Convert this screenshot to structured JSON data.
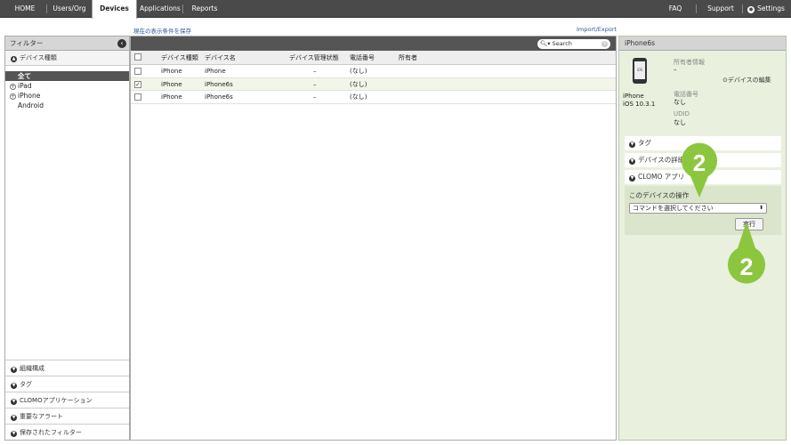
{
  "nav": {
    "items": [
      "HOME",
      "Users/Org",
      "Devices",
      "Applications",
      "Reports"
    ],
    "active": "Devices",
    "right_items": [
      "FAQ",
      "Support",
      "Settings"
    ]
  },
  "links": {
    "save_view": "現在の表示条件を保存",
    "import_export": "Import/Export"
  },
  "filter": {
    "title": "フィルター",
    "device_type_header": "デバイス種類",
    "all_label": "全て",
    "devices": [
      "iPad",
      "iPhone",
      "Android"
    ],
    "bottom_sections": [
      "組織構成",
      "タグ",
      "CLOMOアプリケーション",
      "重要なアラート",
      "保存されたフィルター"
    ]
  },
  "search": {
    "placeholder": "Search"
  },
  "table": {
    "headers": [
      "デバイス種類",
      "デバイス名",
      "デバイス管理状態",
      "電話番号",
      "所有者"
    ],
    "rows": [
      {
        "type": "iPhone",
        "name": "iPhone",
        "state": "–",
        "phone": "(なし)",
        "owner": "",
        "checked": false
      },
      {
        "type": "iPhone",
        "name": "iPhone6s",
        "state": "–",
        "phone": "(なし)",
        "owner": "",
        "checked": true
      },
      {
        "type": "iPhone",
        "name": "iPhone6s",
        "state": "–",
        "phone": "(なし)",
        "owner": "",
        "checked": false
      }
    ]
  },
  "detail": {
    "title": "iPhone6s",
    "phone_screen": "iOS",
    "model": "iPhone",
    "os": "iOS 10.3.1",
    "owner_label": "所有者情報",
    "owner_value": "–",
    "edit_link": "デバイスの編集",
    "phone_label": "電話番号",
    "phone_value": "なし",
    "udid_label": "UDID",
    "udid_value": "なし",
    "sections": [
      "タグ",
      "デバイスの詳細",
      "CLOMO アプリ"
    ],
    "ops_title": "このデバイスの操作",
    "command_select": "コマンドを選択してください",
    "execute": "実行"
  },
  "callout_number": "2",
  "colors": {
    "callout": "#8cc63f",
    "nav_bg": "#4a4a4a",
    "panel_green": "#e9f0dd"
  }
}
